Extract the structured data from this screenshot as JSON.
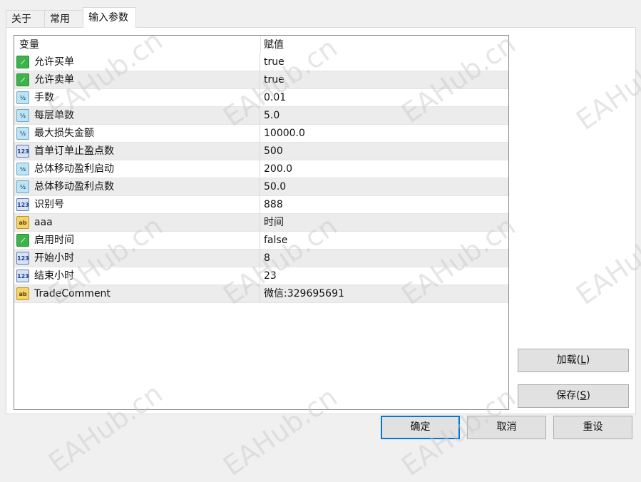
{
  "tabs": [
    {
      "label": "关于"
    },
    {
      "label": "常用"
    },
    {
      "label": "输入参数"
    }
  ],
  "grid": {
    "headers": {
      "variable": "变量",
      "value": "赋值"
    },
    "rows": [
      {
        "type": "bool-icon",
        "name": "允许买单",
        "value": "true"
      },
      {
        "type": "bool-icon",
        "name": "允许卖单",
        "value": "true"
      },
      {
        "type": "double-icon",
        "name": "手数",
        "value": "0.01"
      },
      {
        "type": "double-icon",
        "name": "每层单数",
        "value": "5.0"
      },
      {
        "type": "double-icon",
        "name": "最大损失金额",
        "value": "10000.0"
      },
      {
        "type": "int-icon",
        "name": "首单订单止盈点数",
        "value": "500"
      },
      {
        "type": "double-icon",
        "name": "总体移动盈利启动",
        "value": "200.0"
      },
      {
        "type": "double-icon",
        "name": "总体移动盈利点数",
        "value": "50.0"
      },
      {
        "type": "int-icon",
        "name": "识别号",
        "value": "888"
      },
      {
        "type": "string-icon",
        "name": "aaa",
        "value": "时间"
      },
      {
        "type": "bool-icon",
        "name": "启用时间",
        "value": "false"
      },
      {
        "type": "int-icon",
        "name": "开始小时",
        "value": "8"
      },
      {
        "type": "int-icon",
        "name": "结束小时",
        "value": "23"
      },
      {
        "type": "string-icon",
        "name": "TradeComment",
        "value": "微信:329695691"
      }
    ]
  },
  "icon_glyphs": {
    "bool": "⟋",
    "double": "½",
    "int": "123",
    "string": "ab"
  },
  "buttons": {
    "load": {
      "text": "加载(",
      "key": "L",
      "end": ")"
    },
    "save": {
      "text": "保存(",
      "key": "S",
      "end": ")"
    },
    "ok": "确定",
    "cancel": "取消",
    "reset": "重设"
  },
  "watermark": "EAHub.cn",
  "colors": {
    "accent": "#0078d7",
    "bool": "#3cb44b",
    "string": "#f4d36a"
  }
}
